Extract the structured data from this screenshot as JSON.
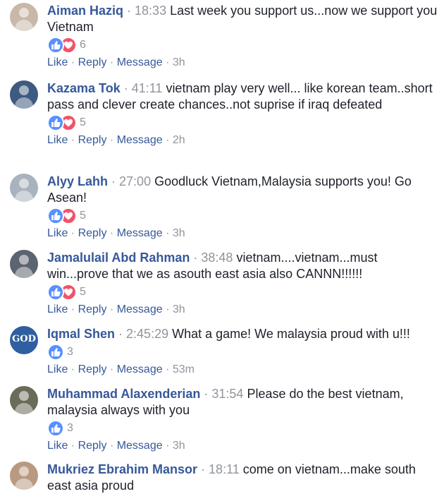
{
  "comments": [
    {
      "author": "Aiman Haziq",
      "timestamp": "18:33",
      "text": "Last week you support us...now we support you Vietnam",
      "reactions": [
        "like",
        "love"
      ],
      "reaction_count": "6",
      "age": "3h",
      "avatar_color": "#c9b8a8"
    },
    {
      "author": "Kazama Tok",
      "timestamp": "41:11",
      "text": "vietnam play very well... like korean team..short pass and clever create chances..not suprise if iraq defeated",
      "reactions": [
        "like",
        "love"
      ],
      "reaction_count": "5",
      "age": "2h",
      "avatar_color": "#3d5a80"
    },
    {
      "author": "Alyy Lahh",
      "timestamp": "27:00",
      "text": "Goodluck Vietnam,Malaysia supports you! Go Asean!",
      "reactions": [
        "like",
        "love"
      ],
      "reaction_count": "5",
      "age": "3h",
      "avatar_color": "#a9b3bd"
    },
    {
      "author": "Jamalulail Abd Rahman",
      "timestamp": "38:48",
      "text": "vietnam....vietnam...must win...prove that we as asouth east asia also CANNN!!!!!!",
      "reactions": [
        "like",
        "love"
      ],
      "reaction_count": "5",
      "age": "3h",
      "avatar_color": "#5b6470"
    },
    {
      "author": "Iqmal Shen",
      "timestamp": "2:45:29",
      "text": "What a game! We malaysia proud with u!!!",
      "reactions": [
        "like"
      ],
      "reaction_count": "3",
      "age": "53m",
      "avatar_color": "#2f5fa0",
      "avatar_text": "GOD"
    },
    {
      "author": "Muhammad Alaxenderian",
      "timestamp": "31:54",
      "text": "Please do the best vietnam, malaysia always with you",
      "reactions": [
        "like"
      ],
      "reaction_count": "3",
      "age": "3h",
      "avatar_color": "#6b6b5a"
    },
    {
      "author": "Mukriez Ebrahim Mansor",
      "timestamp": "18:11",
      "text": "come on vietnam...make south east asia proud",
      "reactions": [],
      "reaction_count": "",
      "age": "",
      "avatar_color": "#b89a82"
    }
  ],
  "labels": {
    "like": "Like",
    "reply": "Reply",
    "message": "Message",
    "separator": " · "
  },
  "colors": {
    "link": "#365899",
    "meta": "#90949c",
    "like_reaction": "#5890ff",
    "love_reaction": "#f25268"
  }
}
